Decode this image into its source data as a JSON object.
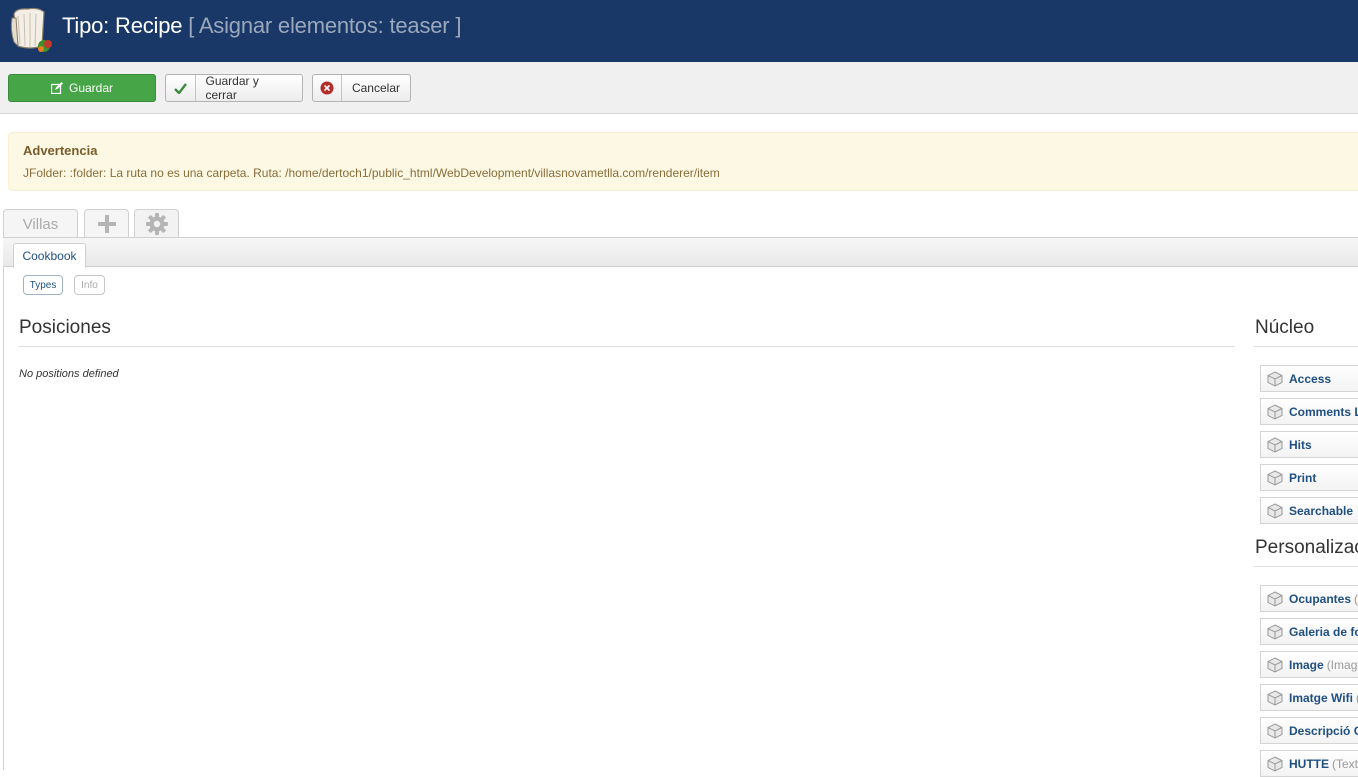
{
  "header": {
    "title_main": "Tipo: Recipe",
    "title_sub": "[ Asignar elementos: teaser ]"
  },
  "toolbar": {
    "save_label": "Guardar",
    "save_close_label": "Guardar y cerrar",
    "cancel_label": "Cancelar"
  },
  "warning": {
    "title": "Advertencia",
    "message": "JFolder: :folder: La ruta no es una carpeta. Ruta: /home/dertoch1/public_html/WebDevelopment/villasnovametlla.com/renderer/item"
  },
  "app_tabs": {
    "villas_label": "Villas",
    "add_icon": "plus-icon",
    "settings_icon": "gear-icon"
  },
  "sub_tab": {
    "label": "Cookbook"
  },
  "pills": {
    "types": "Types",
    "info": "Info"
  },
  "positions": {
    "title": "Posiciones",
    "empty": "No positions defined"
  },
  "core": {
    "title": "Núcleo",
    "items": [
      {
        "name": "Access",
        "type": ""
      },
      {
        "name": "Comments L",
        "type": ""
      },
      {
        "name": "Hits",
        "type": ""
      },
      {
        "name": "Print",
        "type": ""
      },
      {
        "name": "Searchable",
        "type": ""
      }
    ]
  },
  "custom": {
    "title": "Personalizac",
    "items": [
      {
        "name": "Ocupantes",
        "type": "("
      },
      {
        "name": "Galeria de fo",
        "type": ""
      },
      {
        "name": "Image",
        "type": "(Image"
      },
      {
        "name": "Imatge Wifi",
        "type": "("
      },
      {
        "name": "Descripció C",
        "type": ""
      },
      {
        "name": "HUTTE",
        "type": "(Text"
      }
    ]
  },
  "colors": {
    "header_bg": "#1a3867",
    "save_button": "#46a546",
    "warning_bg": "#fcf8e3",
    "link_blue": "#205081"
  }
}
